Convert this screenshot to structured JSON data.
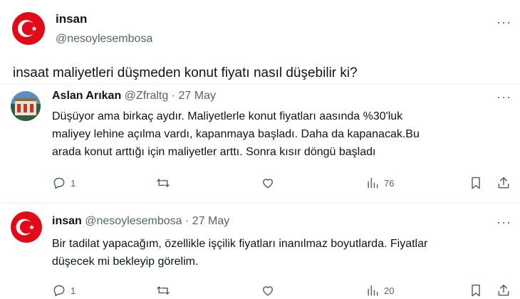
{
  "colors": {
    "flag_red": "#e30a17",
    "text": "#0f1419",
    "muted": "#536471",
    "divider": "#eff3f4"
  },
  "main_post": {
    "display_name": "insan",
    "handle": "@nesoylesembosa",
    "text": "insaat maliyetleri düşmeden konut fiyatı nasıl düşebilir ki?",
    "more_icon": "more-dots-icon"
  },
  "reply1": {
    "display_name": "Aslan Arıkan",
    "handle": "@Zfraltg",
    "separator": "·",
    "date": "27 May",
    "lines": [
      "Düşüyor ama birkaç aydır. Maliyetlerle konut fiyatları aasında %30'luk",
      "maliyey lehine açılma vardı, kapanmaya başladı. Daha da kapanacak.Bu",
      "arada konut arttığı için maliyetler arttı. Sonra kısır döngü başladı"
    ],
    "reply_count": "1",
    "views": "76"
  },
  "reply2": {
    "display_name": "insan",
    "handle": "@nesoylesembosa",
    "separator": "·",
    "date": "27 May",
    "lines": [
      "Bir tadilat yapacağım, özellikle işçilik fiyatları inanılmaz boyutlarda. Fiyatlar",
      "düşecek mi bekleyip görelim."
    ],
    "reply_count": "1",
    "views": "20"
  },
  "icons": [
    "reply-icon",
    "retweet-icon",
    "like-icon",
    "views-icon",
    "bookmark-icon",
    "share-icon",
    "more-dots-icon"
  ]
}
